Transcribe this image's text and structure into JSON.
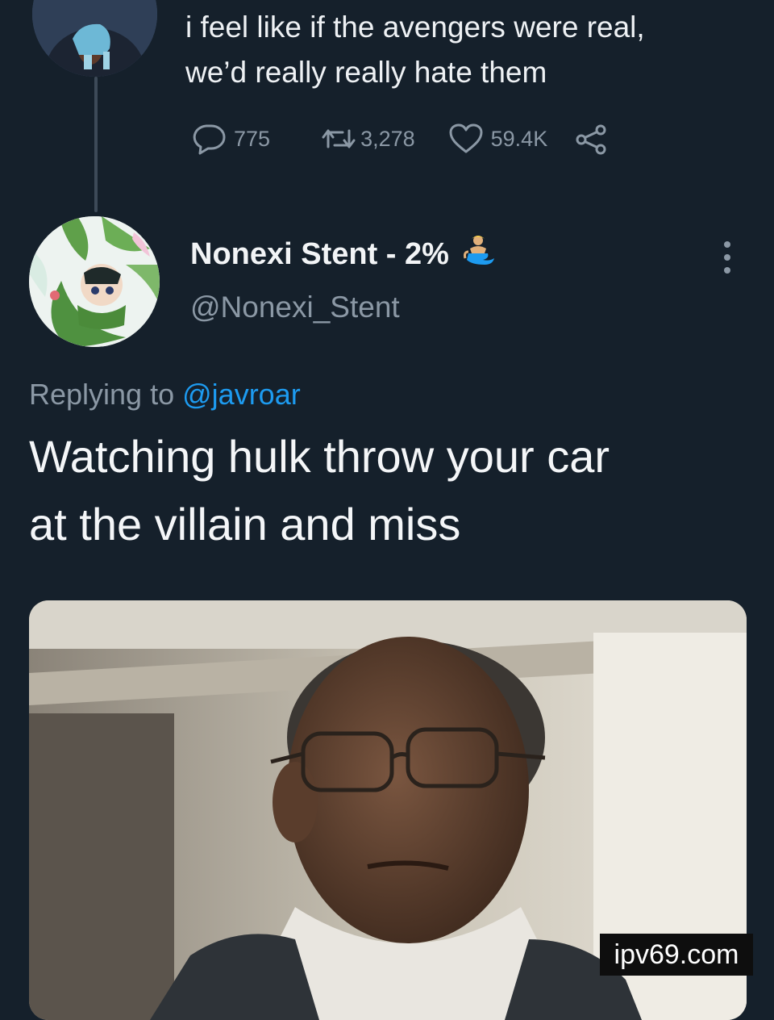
{
  "parent_tweet": {
    "text_lines": [
      "i feel like if the avengers were real,",
      "we’d really really hate them"
    ],
    "replies": "775",
    "retweets": "3,278",
    "likes": "59.4K"
  },
  "reply_tweet": {
    "display_name": "Nonexi Stent - 2%",
    "handle": "@Nonexi_Stent",
    "replying_prefix": "Replying to",
    "replying_to": "@javroar",
    "text_lines": [
      "Watching hulk throw your car",
      "at the villain and miss"
    ]
  },
  "watermark": "ipv69.com",
  "icons": {
    "reply": "speech-bubble-icon",
    "retweet": "retweet-arrows-icon",
    "like": "heart-icon",
    "share": "share-nodes-icon",
    "more": "vertical-ellipsis-icon",
    "emoji": "merperson-emoji-icon"
  },
  "colors": {
    "background": "#15202b",
    "secondary_text": "#8b98a5",
    "link": "#1d9bf0",
    "primary_text": "#f4f6f8"
  }
}
